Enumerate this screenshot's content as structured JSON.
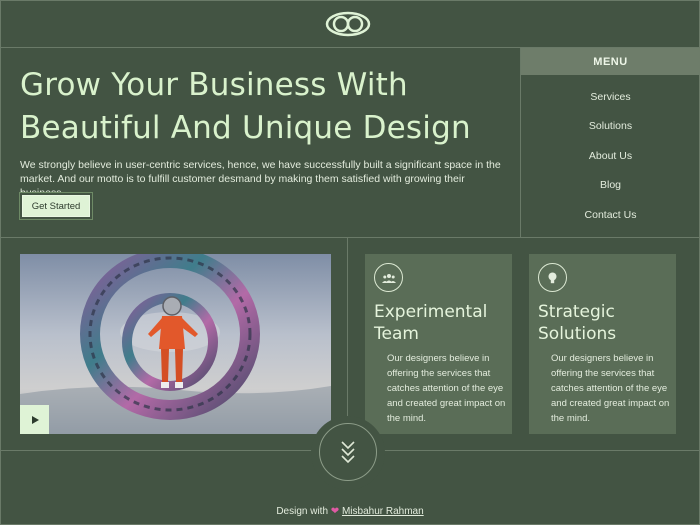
{
  "header": {
    "logo_icon": "infinity-logo-icon"
  },
  "hero": {
    "title_line1": "Grow Your Business With",
    "title_line2": "Beautiful And Unique Design",
    "description": "We strongly believe in user-centric services, hence, we have successfully built a significant space in the market. And our motto is to fulfill customer desmand by making them satisfied with growing their business.",
    "cta_label": "Get Started"
  },
  "menu": {
    "heading": "MENU",
    "items": [
      {
        "label": "Services"
      },
      {
        "label": "Solutions"
      },
      {
        "label": "About Us"
      },
      {
        "label": "Blog"
      },
      {
        "label": "Contact Us"
      }
    ]
  },
  "media": {
    "play_icon": "play-icon"
  },
  "cards": [
    {
      "icon": "team-icon",
      "title_line1": "Experimental",
      "title_line2": "Team",
      "text": "Our designers believe in offering the services that catches attention of the eye and created great impact on the mind."
    },
    {
      "icon": "lightbulb-icon",
      "title_line1": "Strategic",
      "title_line2": "Solutions",
      "text": "Our designers believe in offering the services that catches attention of the eye and created great impact on the mind."
    }
  ],
  "scroll": {
    "icon": "double-chevron-down-icon"
  },
  "footer": {
    "prefix": "Design with",
    "heart_icon": "heart-icon",
    "author": "Misbahur Rahman"
  },
  "colors": {
    "background": "#435443",
    "accent": "#dff3d6",
    "card": "#5a6d57",
    "menu_header": "#6e7d6a"
  }
}
